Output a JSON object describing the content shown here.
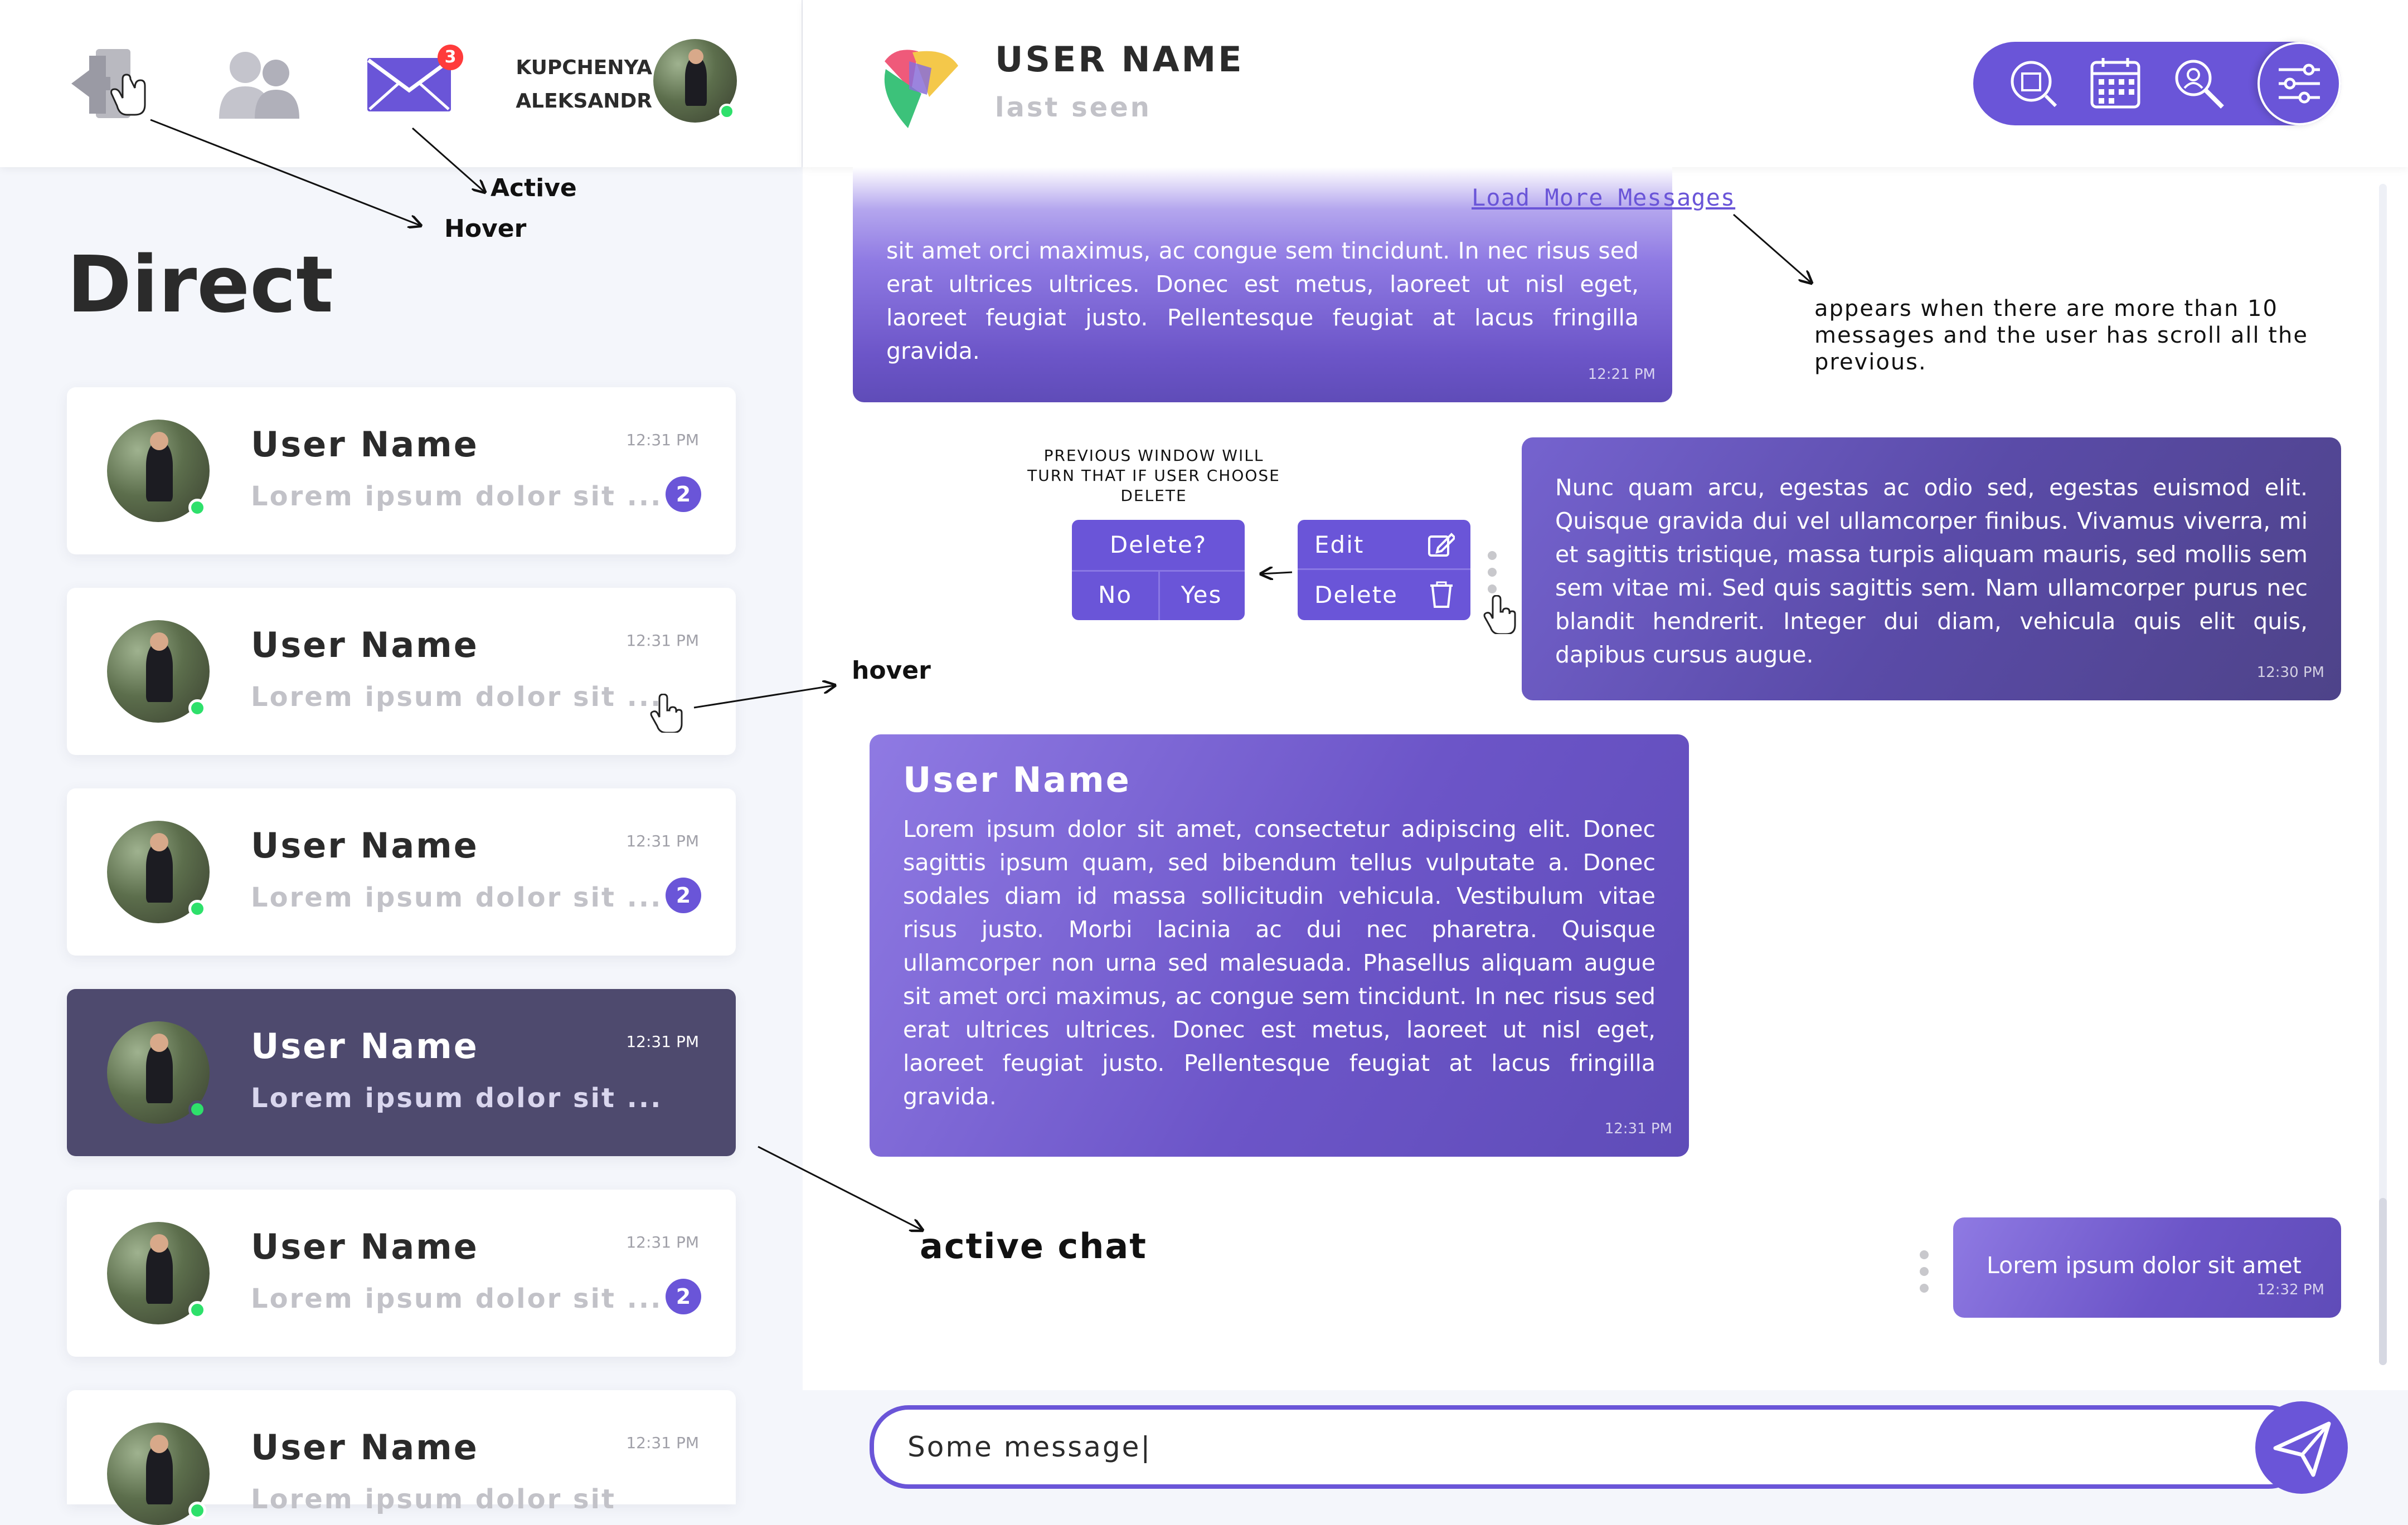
{
  "header": {
    "user_name_line1": "KUPCHENYA",
    "user_name_line2": "ALEKSANDR",
    "mail_badge": "3",
    "chat_title": "USER NAME",
    "chat_status": "last seen"
  },
  "sidebar": {
    "title": "Direct",
    "chats": [
      {
        "name": "User Name",
        "preview": "Lorem ipsum dolor sit ...",
        "time": "12:31 PM",
        "unread": "2"
      },
      {
        "name": "User Name",
        "preview": "Lorem ipsum dolor sit ...",
        "time": "12:31 PM",
        "unread": ""
      },
      {
        "name": "User Name",
        "preview": "Lorem ipsum dolor sit ...",
        "time": "12:31 PM",
        "unread": "2"
      },
      {
        "name": "User Name",
        "preview": "Lorem ipsum dolor sit ...",
        "time": "12:31 PM",
        "unread": ""
      },
      {
        "name": "User Name",
        "preview": "Lorem ipsum dolor sit ...",
        "time": "12:31 PM",
        "unread": "2"
      },
      {
        "name": "User Name",
        "preview": "Lorem ipsum dolor sit",
        "time": "12:31 PM",
        "unread": ""
      }
    ]
  },
  "messages": {
    "load_more": "Load More Messages",
    "msg1_text": "sit amet orci maximus, ac congue sem tincidunt. In nec risus sed erat ultrices ultrices. Donec est metus, laoreet ut nisl eget, laoreet feugiat justo. Pellentesque feugiat at lacus fringilla gravida.",
    "msg1_time": "12:21 PM",
    "msg2_text": "Nunc quam arcu, egestas ac odio sed, egestas euismod elit. Quisque gravida dui vel ullamcorper finibus. Vivamus viverra, mi et sagittis tristique, massa turpis aliquam mauris, sed mollis sem sem vitae mi. Sed quis sagittis sem. Nam ullamcorper purus nec blandit hendrerit. Integer dui diam, vehicula quis elit quis, dapibus cursus augue.",
    "msg2_time": "12:30 PM",
    "msg3_name": "User Name",
    "msg3_text": "Lorem ipsum dolor sit amet, consectetur adipiscing elit. Donec sagittis ipsum quam, sed bibendum tellus vulputate a. Donec sodales diam id massa sollicitudin vehicula. Vestibulum vitae risus justo. Morbi lacinia ac dui nec pharetra. Quisque ullamcorper non urna sed malesuada. Phasellus aliquam augue sit amet orci maximus, ac congue sem tincidunt. In nec risus sed erat ultrices ultrices. Donec est metus, laoreet ut nisl eget, laoreet feugiat justo. Pellentesque feugiat at lacus fringilla gravida.",
    "msg3_time": "12:31 PM",
    "msg4_text": "Lorem ipsum dolor sit amet",
    "msg4_time": "12:32 PM"
  },
  "context_menu": {
    "edit": "Edit",
    "delete": "Delete",
    "confirm_title": "Delete?",
    "no": "No",
    "yes": "Yes"
  },
  "composer": {
    "value": "Some message|"
  },
  "annotations": {
    "active": "Active",
    "hover_top": "Hover",
    "hover_side": "hover",
    "active_chat": "active chat",
    "load_more_note": "appears when there are more than 10 messages and the user has scroll all the previous.",
    "delete_note": "PREVIOUS WINDOW WILL TURN THAT IF USER CHOOSE DELETE"
  },
  "colors": {
    "accent": "#6a55d8",
    "active_chat_bg": "#4e4a6e",
    "online": "#2ee06b",
    "notification": "#ff3b3b"
  }
}
